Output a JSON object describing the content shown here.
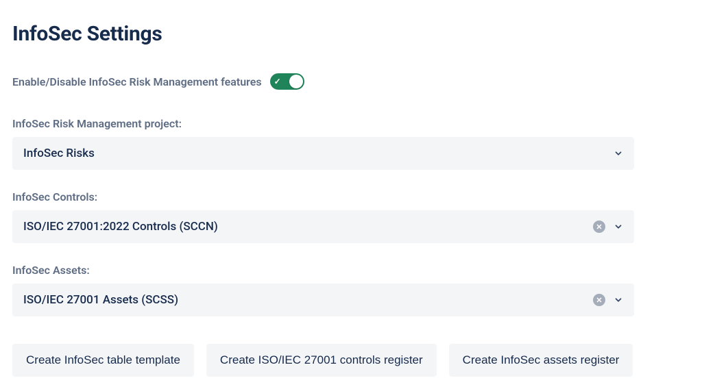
{
  "page": {
    "title": "InfoSec Settings"
  },
  "toggle": {
    "label": "Enable/Disable InfoSec Risk Management features",
    "enabled": true
  },
  "fields": {
    "project": {
      "label": "InfoSec Risk Management project:",
      "value": "InfoSec Risks",
      "clearable": false
    },
    "controls": {
      "label": "InfoSec Controls:",
      "value": "ISO/IEC 27001:2022 Controls (SCCN)",
      "clearable": true
    },
    "assets": {
      "label": "InfoSec Assets:",
      "value": "ISO/IEC 27001 Assets (SCSS)",
      "clearable": true
    }
  },
  "buttons": {
    "create_table_template": "Create InfoSec table template",
    "create_controls_register": "Create ISO/IEC 27001 controls register",
    "create_assets_register": "Create InfoSec assets register"
  }
}
